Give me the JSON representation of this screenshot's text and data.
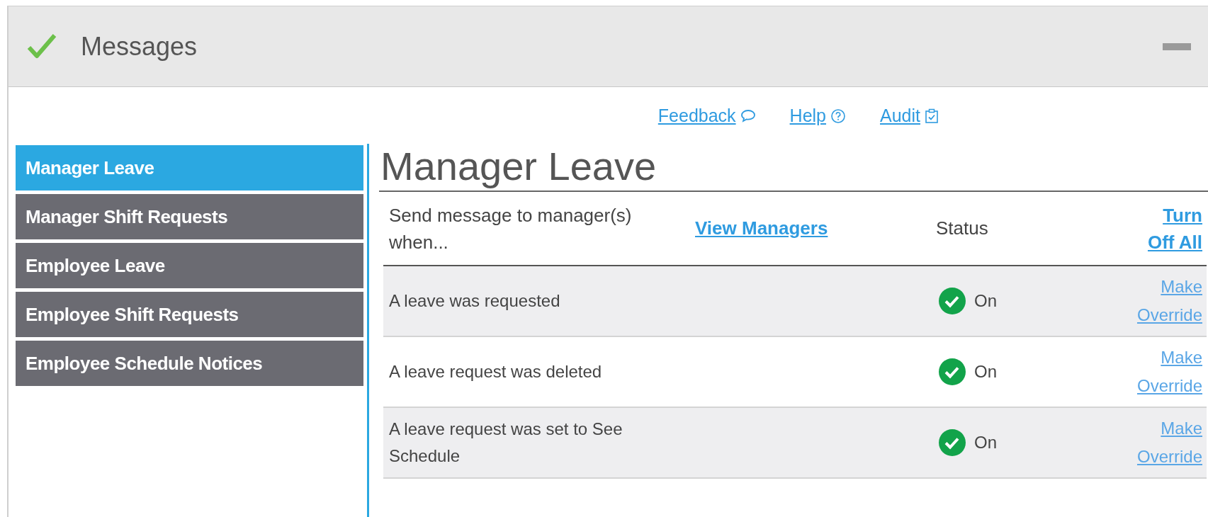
{
  "header": {
    "title": "Messages"
  },
  "links": [
    {
      "label": "Feedback",
      "kind": "feedback"
    },
    {
      "label": "Help",
      "kind": "help"
    },
    {
      "label": "Audit",
      "kind": "audit"
    }
  ],
  "sidebar": {
    "items": [
      {
        "label": "Manager Leave",
        "selected": true
      },
      {
        "label": "Manager Shift Requests",
        "selected": false
      },
      {
        "label": "Employee Leave",
        "selected": false
      },
      {
        "label": "Employee Shift Requests",
        "selected": false
      },
      {
        "label": "Employee Schedule Notices",
        "selected": false
      }
    ]
  },
  "content": {
    "title": "Manager Leave",
    "table": {
      "columns": {
        "description": "Send message to manager(s) when...",
        "view_link": "View Managers",
        "status": "Status",
        "action": "Turn Off All"
      },
      "rows": [
        {
          "event": "A leave was requested",
          "on": true,
          "status": "On",
          "action": "Make Override"
        },
        {
          "event": "A leave request was deleted",
          "on": true,
          "status": "On",
          "action": "Make Override"
        },
        {
          "event": "A leave request was set to See Schedule",
          "on": true,
          "status": "On",
          "action": "Make Override"
        }
      ]
    }
  }
}
